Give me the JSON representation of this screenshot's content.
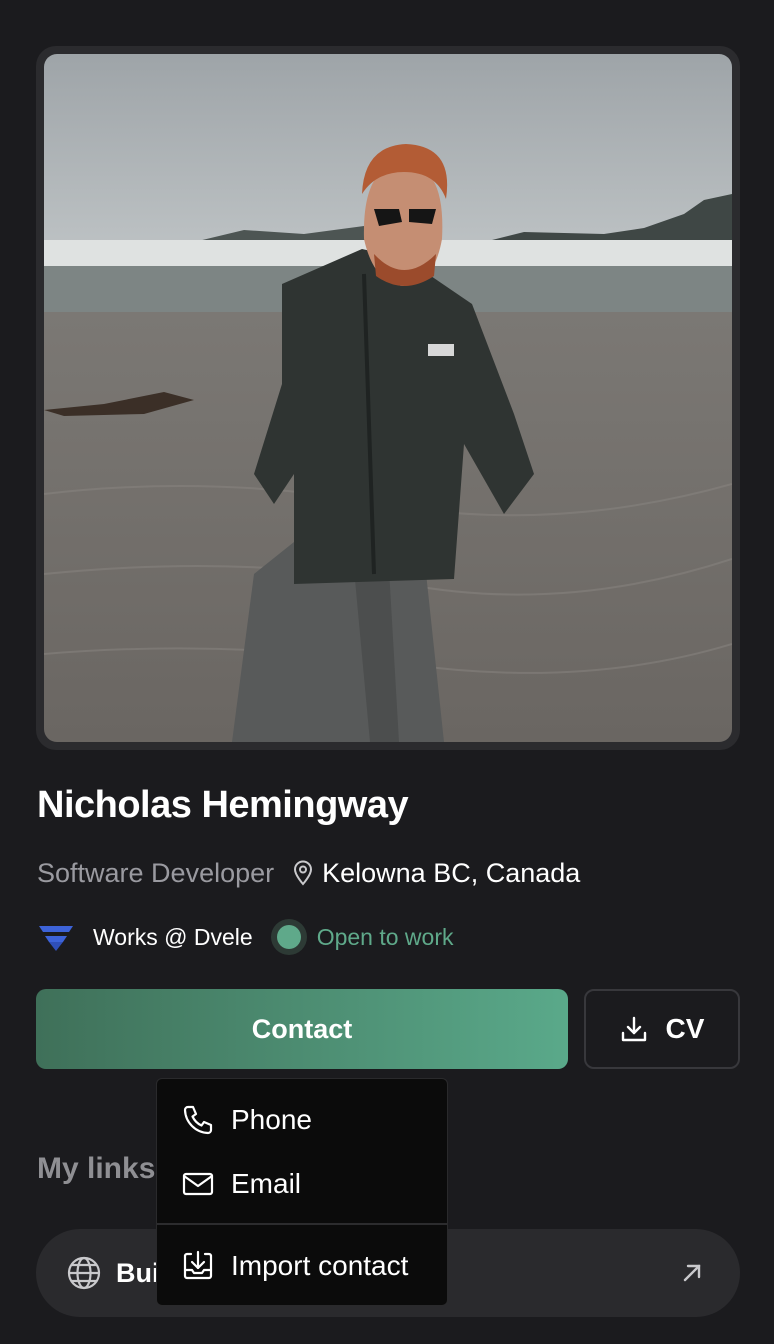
{
  "profile": {
    "name": "Nicholas Hemingway",
    "role": "Software Developer",
    "location": "Kelowna BC, Canada",
    "company": "Works @ Dvele",
    "status": "Open to work",
    "photo_icon": "profile-photo-beach"
  },
  "actions": {
    "contact_label": "Contact",
    "cv_label": "CV"
  },
  "links_section": {
    "heading": "My links",
    "items": [
      {
        "label": "Bui",
        "icon": "globe-icon"
      }
    ]
  },
  "contact_menu": {
    "items": [
      {
        "label": "Phone",
        "icon": "phone-icon"
      },
      {
        "label": "Email",
        "icon": "mail-icon"
      },
      {
        "label": "Import contact",
        "icon": "import-icon"
      }
    ]
  },
  "colors": {
    "background": "#1b1b1e",
    "accent": "#5aa98a",
    "status": "#5fa98a",
    "muted_text": "#9a9aa0"
  }
}
